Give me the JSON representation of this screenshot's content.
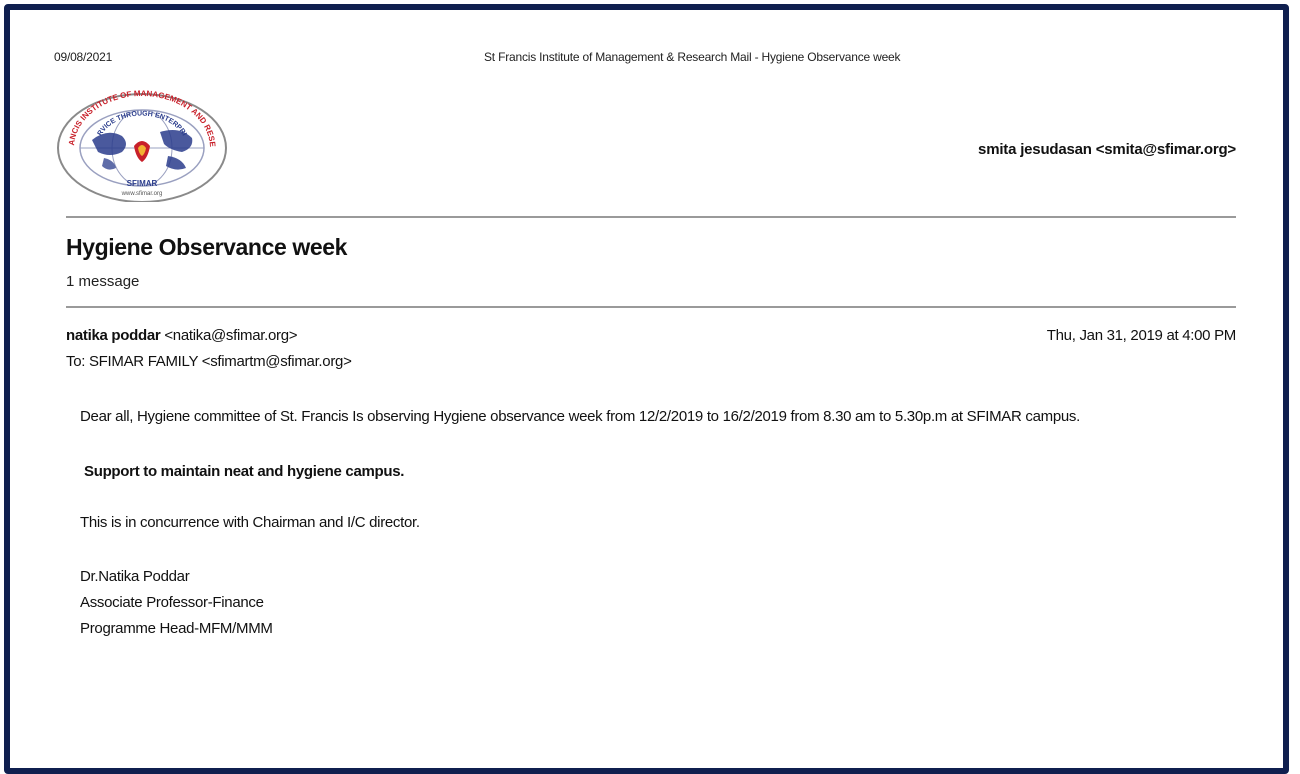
{
  "print_header": {
    "date": "09/08/2021",
    "title": "St Francis Institute of Management & Research Mail - Hygiene Observance week"
  },
  "logo": {
    "arc_text_top": "ST. FRANCIS INSTITUTE OF MANAGEMENT AND RESEARCH",
    "inner_text": "SERVICE THROUGH ENTERPRISE",
    "name": "SFIMAR",
    "url": "www.sfimar.org"
  },
  "account": "smita jesudasan <smita@sfimar.org>",
  "thread": {
    "subject": "Hygiene Observance week",
    "count": "1 message"
  },
  "message": {
    "sender_name": "natika poddar",
    "sender_email": " <natika@sfimar.org>",
    "to": "To: SFIMAR FAMILY <sfimartm@sfimar.org>",
    "date": "Thu, Jan 31, 2019 at 4:00 PM",
    "body": {
      "para1": "Dear all, Hygiene committee of St. Francis Is observing Hygiene observance week from 12/2/2019 to 16/2/2019 from 8.30 am to 5.30p.m at SFIMAR campus.",
      "para2": "Support to maintain neat and hygiene campus.",
      "para3": "This is in concurrence with Chairman and I/C director."
    },
    "signature": {
      "line1": "Dr.Natika Poddar",
      "line2": "Associate Professor-Finance",
      "line3": "Programme Head-MFM/MMM"
    }
  },
  "colors": {
    "frame": "#0f1f4f",
    "rule": "#9a9a9a",
    "logo_red": "#c8202a",
    "logo_blue": "#2a3c8c"
  }
}
